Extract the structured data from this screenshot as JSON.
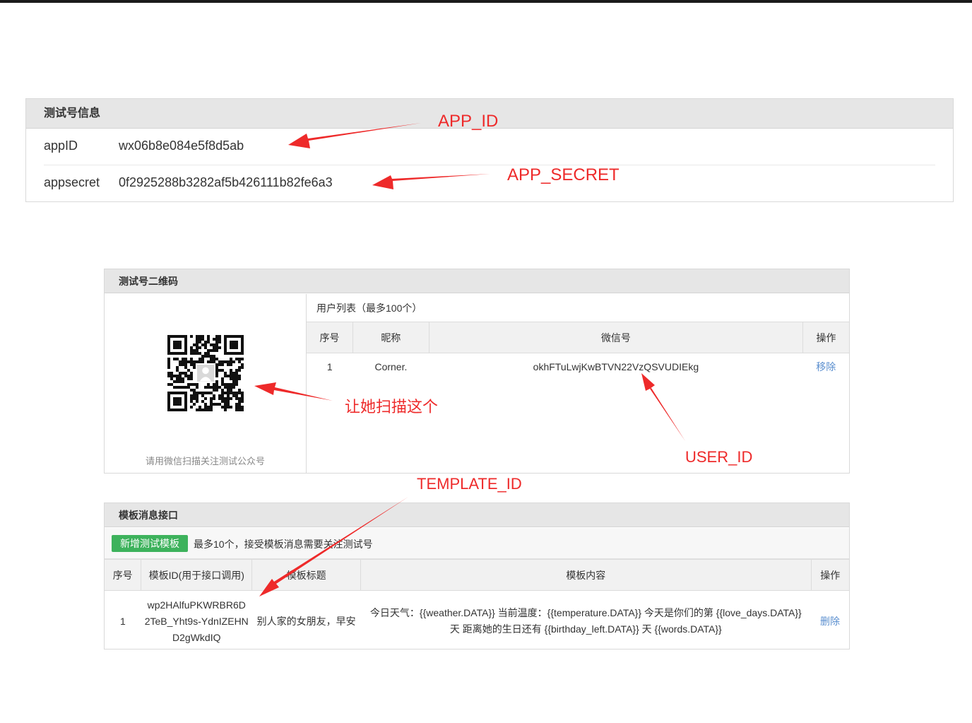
{
  "info": {
    "title": "测试号信息",
    "app_id_label": "appID",
    "app_id_value": "wx06b8e084e5f8d5ab",
    "app_secret_label": "appsecret",
    "app_secret_value": "0f2925288b3282af5b426111b82fe6a3"
  },
  "qr": {
    "title": "测试号二维码",
    "caption": "请用微信扫描关注测试公众号",
    "user_list_title": "用户列表（最多100个）",
    "columns": [
      "序号",
      "昵称",
      "微信号",
      "操作"
    ],
    "rows": [
      {
        "index": "1",
        "nickname": "Corner.",
        "wechat_id": "okhFTuLwjKwBTVN22VzQSVUDIEkg",
        "action": "移除"
      }
    ]
  },
  "template": {
    "title": "模板消息接口",
    "add_button": "新增测试模板",
    "note": "最多10个，接受模板消息需要关注测试号",
    "columns": [
      "序号",
      "模板ID(用于接口调用)",
      "模板标题",
      "模板内容",
      "操作"
    ],
    "rows": [
      {
        "index": "1",
        "template_id": "wp2HAlfuPKWRBR6D2TeB_Yht9s-YdnIZEHND2gWkdIQ",
        "template_id_lines": [
          "wp2HAlfuPKWRBR6D",
          "2TeB_Yht9s-YdnIZEHN",
          "D2gWkdIQ"
        ],
        "title": "别人家的女朋友，早安",
        "content_lines": [
          "今日天气：{{weather.DATA}} 当前温度：{{temperature.DATA}} 今天是你们的第 {{love_days.DATA}}",
          "天 距离她的生日还有 {{birthday_left.DATA}} 天 {{words.DATA}}"
        ],
        "action": "删除"
      }
    ]
  },
  "annotations": {
    "app_id": "APP_ID",
    "app_secret": "APP_SECRET",
    "scan_hint": "让她扫描这个",
    "user_id": "USER_ID",
    "template_id": "TEMPLATE_ID",
    "color": "#ee2a2a"
  },
  "colors": {
    "panel_header": "#e6e6e6",
    "button_green": "#3db25c",
    "link_blue": "#5b8fcf"
  }
}
